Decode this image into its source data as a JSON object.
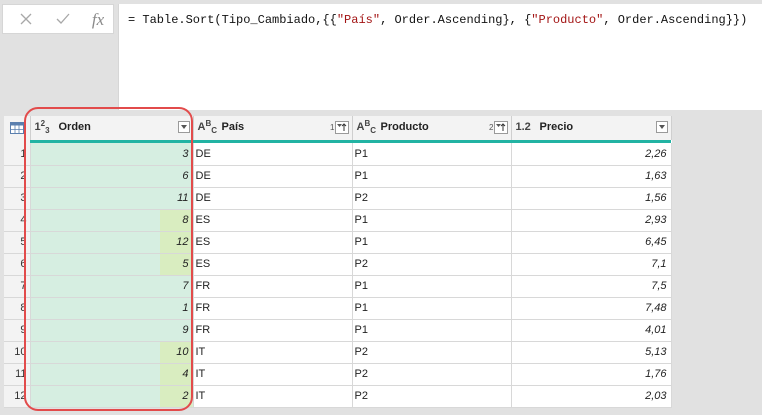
{
  "formula_bar": {
    "formula_prefix": "= Table.Sort(Tipo_Cambiado,{{",
    "str1": "\"País\"",
    "mid1": ", Order.Ascending}, {",
    "str2": "\"Producto\"",
    "mid2": ", Order.Ascending}})",
    "fx_label": "fx"
  },
  "table": {
    "columns": [
      {
        "type_main": "1",
        "type_sup": "2",
        "type_sub": "3",
        "name": "Orden"
      },
      {
        "type_main": "A",
        "type_sup": "B",
        "type_sub": "C",
        "name": "País",
        "sort_index": "1"
      },
      {
        "type_main": "A",
        "type_sup": "B",
        "type_sub": "C",
        "name": "Producto",
        "sort_index": "2"
      },
      {
        "type_main": "1.2",
        "name": "Precio"
      }
    ],
    "rows": [
      {
        "n": "1",
        "orden": "3",
        "pais": "DE",
        "producto": "P1",
        "precio": "2,26"
      },
      {
        "n": "2",
        "orden": "6",
        "pais": "DE",
        "producto": "P1",
        "precio": "1,63"
      },
      {
        "n": "3",
        "orden": "11",
        "pais": "DE",
        "producto": "P2",
        "precio": "1,56"
      },
      {
        "n": "4",
        "orden": "8",
        "pais": "ES",
        "producto": "P1",
        "precio": "2,93"
      },
      {
        "n": "5",
        "orden": "12",
        "pais": "ES",
        "producto": "P1",
        "precio": "6,45"
      },
      {
        "n": "6",
        "orden": "5",
        "pais": "ES",
        "producto": "P2",
        "precio": "7,1"
      },
      {
        "n": "7",
        "orden": "7",
        "pais": "FR",
        "producto": "P1",
        "precio": "7,5"
      },
      {
        "n": "8",
        "orden": "1",
        "pais": "FR",
        "producto": "P1",
        "precio": "7,48"
      },
      {
        "n": "9",
        "orden": "9",
        "pais": "FR",
        "producto": "P1",
        "precio": "4,01"
      },
      {
        "n": "10",
        "orden": "10",
        "pais": "IT",
        "producto": "P2",
        "precio": "5,13"
      },
      {
        "n": "11",
        "orden": "4",
        "pais": "IT",
        "producto": "P2",
        "precio": "1,76"
      },
      {
        "n": "12",
        "orden": "2",
        "pais": "IT",
        "producto": "P2",
        "precio": "2,03"
      }
    ]
  },
  "colors": {
    "header_accent": "#22b3a3",
    "selected_column": "#d6eee1",
    "highlight_cell": "#d9edc0",
    "annotation": "#e24b4b"
  }
}
